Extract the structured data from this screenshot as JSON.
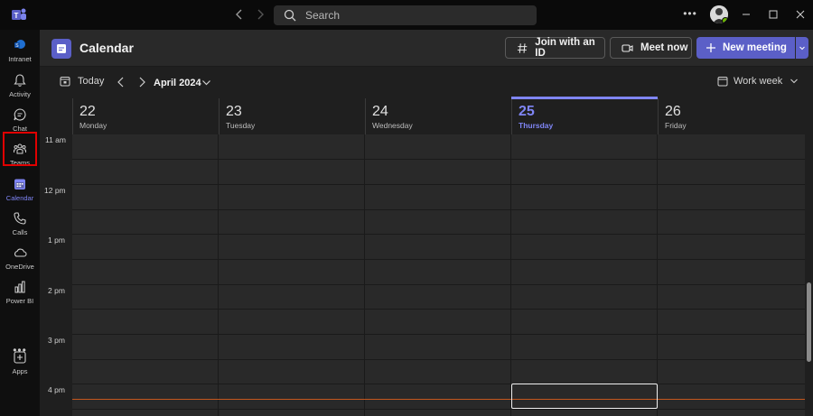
{
  "titlebar": {
    "search_placeholder": "Search"
  },
  "rail": {
    "items": [
      {
        "label": "Intranet"
      },
      {
        "label": "Activity"
      },
      {
        "label": "Chat"
      },
      {
        "label": "Teams"
      },
      {
        "label": "Calendar"
      },
      {
        "label": "Calls"
      },
      {
        "label": "OneDrive"
      },
      {
        "label": "Power BI"
      },
      {
        "label": "Apps"
      }
    ]
  },
  "header": {
    "title": "Calendar",
    "join_label": "Join with an ID",
    "meet_label": "Meet now",
    "new_label": "New meeting"
  },
  "toolbar": {
    "today_label": "Today",
    "month_label": "April 2024",
    "view_label": "Work week"
  },
  "days": [
    {
      "num": "22",
      "name": "Monday"
    },
    {
      "num": "23",
      "name": "Tuesday"
    },
    {
      "num": "24",
      "name": "Wednesday"
    },
    {
      "num": "25",
      "name": "Thursday"
    },
    {
      "num": "26",
      "name": "Friday"
    }
  ],
  "hours": [
    "11 am",
    "12 pm",
    "1 pm",
    "2 pm",
    "3 pm",
    "4 pm"
  ],
  "colors": {
    "accent": "#5b5fc7",
    "today": "#7f85f5",
    "now_line": "#c4571e",
    "highlight": "#e00000"
  }
}
